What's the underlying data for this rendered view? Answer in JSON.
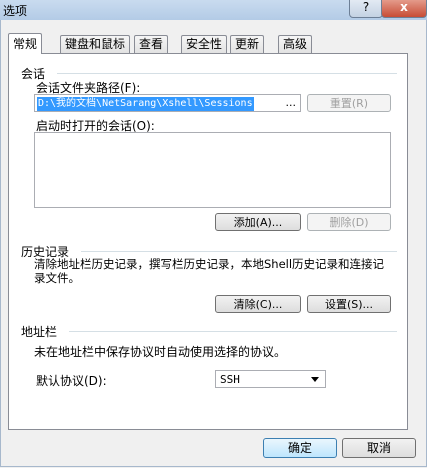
{
  "window": {
    "title": "选项",
    "help_label": "?",
    "close_label": "x"
  },
  "tabs": [
    {
      "label": "常规"
    },
    {
      "label": "键盘和鼠标"
    },
    {
      "label": "查看"
    },
    {
      "label": "安全性"
    },
    {
      "label": "更新"
    },
    {
      "label": "高级"
    }
  ],
  "session": {
    "group_label": "会话",
    "path_label": "会话文件夹路径(F):",
    "path_value": "D:\\我的文档\\NetSarang\\Xshell\\Sessions",
    "browse_label": "...",
    "reset_label": "重置(R)",
    "startup_label": "启动时打开的会话(O):",
    "add_label": "添加(A)...",
    "delete_label": "删除(D)"
  },
  "history": {
    "group_label": "历史记录",
    "description": "清除地址栏历史记录，撰写栏历史记录，本地Shell历史记录和连接记录文件。",
    "clear_label": "清除(C)...",
    "settings_label": "设置(S)..."
  },
  "address": {
    "group_label": "地址栏",
    "description": "未在地址栏中保存协议时自动使用选择的协议。",
    "protocol_label": "默认协议(D):",
    "protocol_value": "SSH"
  },
  "footer": {
    "ok_label": "确定",
    "cancel_label": "取消"
  }
}
